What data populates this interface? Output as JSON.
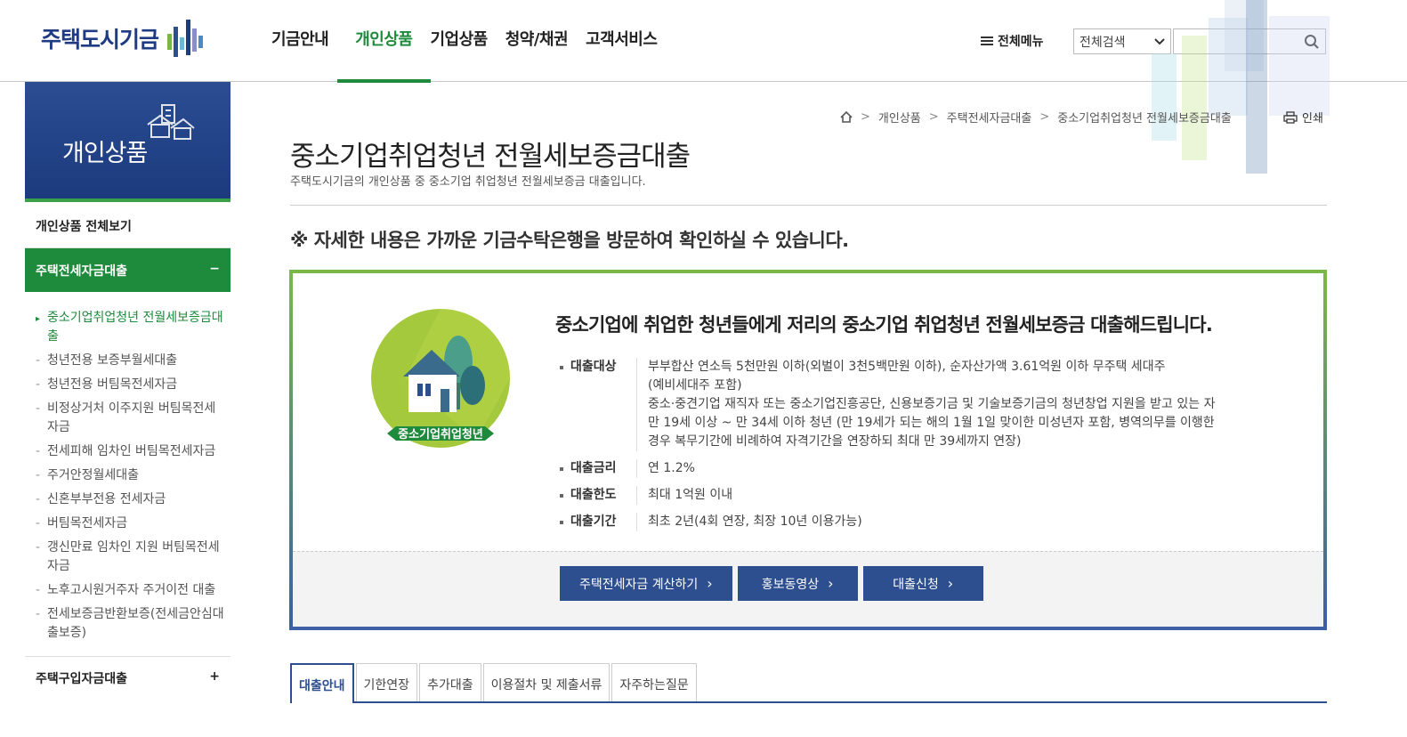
{
  "header": {
    "logo_text": "주택도시기금",
    "gnb": [
      {
        "label": "기금안내",
        "active": false
      },
      {
        "label": "개인상품",
        "active": true
      },
      {
        "label": "기업상품",
        "active": false
      },
      {
        "label": "청약/채권",
        "active": false
      },
      {
        "label": "고객서비스",
        "active": false
      }
    ],
    "allmenu_label": "전체메뉴",
    "search_select_value": "전체검색",
    "search_placeholder": ""
  },
  "lnb": {
    "title": "개인상품",
    "all_label": "개인상품 전체보기",
    "group1": "주택전세자금대출",
    "group1_toggle": "−",
    "items": [
      "중소기업취업청년 전월세보증금대출",
      "청년전용 보증부월세대출",
      "청년전용 버팀목전세자금",
      "비정상거처 이주지원 버팀목전세자금",
      "전세피해 임차인 버팀목전세자금",
      "주거안정월세대출",
      "신혼부부전용 전세자금",
      "버팀목전세자금",
      "갱신만료 임차인 지원 버팀목전세자금",
      "노후고시원거주자 주거이전 대출",
      "전세보증금반환보증(전세금안심대출보증)"
    ],
    "group2": "주택구입자금대출",
    "group2_toggle": "+"
  },
  "breadcrumb": [
    "개인상품",
    "주택전세자금대출",
    "중소기업취업청년 전월세보증금대출"
  ],
  "print_label": "인쇄",
  "page": {
    "title": "중소기업취업청년 전월세보증금대출",
    "desc": "주택도시기금의 개인상품 중 중소기업 취업청년 전월세보증금 대출입니다.",
    "notice": "※ 자세한 내용은 가까운 기금수탁은행을 방문하여 확인하실 수 있습니다."
  },
  "card": {
    "badge_label": "중소기업취업청년",
    "headline": "중소기업에 취업한 청년들에게 저리의 중소기업 취업청년 전월세보증금 대출해드립니다.",
    "rows": [
      {
        "key": "대출대상",
        "lines": [
          "부부합산 연소득 5천만원 이하(외벌이 3천5백만원 이하), 순자산가액 3.61억원 이하 무주택 세대주",
          "(예비세대주 포함)",
          "중소·중견기업 재직자 또는 중소기업진흥공단, 신용보증기금 및 기술보증기금의 청년창업 지원을 받고 있는 자",
          "만 19세 이상 ~ 만 34세 이하 청년 (만 19세가 되는 해의 1월 1일 맞이한 미성년자 포함, 병역의무를 이행한",
          "경우 복무기간에 비례하여 자격기간을 연장하되 최대 만 39세까지 연장)"
        ]
      },
      {
        "key": "대출금리",
        "lines": [
          "연 1.2%"
        ]
      },
      {
        "key": "대출한도",
        "lines": [
          "최대 1억원 이내"
        ]
      },
      {
        "key": "대출기간",
        "lines": [
          "최초 2년(4회 연장, 최장 10년 이용가능)"
        ]
      }
    ],
    "buttons": [
      "주택전세자금 계산하기",
      "홍보동영상",
      "대출신청"
    ]
  },
  "tabs": [
    {
      "label": "대출안내",
      "active": true
    },
    {
      "label": "기한연장",
      "active": false
    },
    {
      "label": "추가대출",
      "active": false
    },
    {
      "label": "이용절차 및 제출서류",
      "active": false
    },
    {
      "label": "자주하는질문",
      "active": false
    }
  ],
  "colors": {
    "brand_green": "#1e8a3c",
    "brand_navy": "#2d4e8f",
    "lnb_navy": "#1c3a7e"
  }
}
